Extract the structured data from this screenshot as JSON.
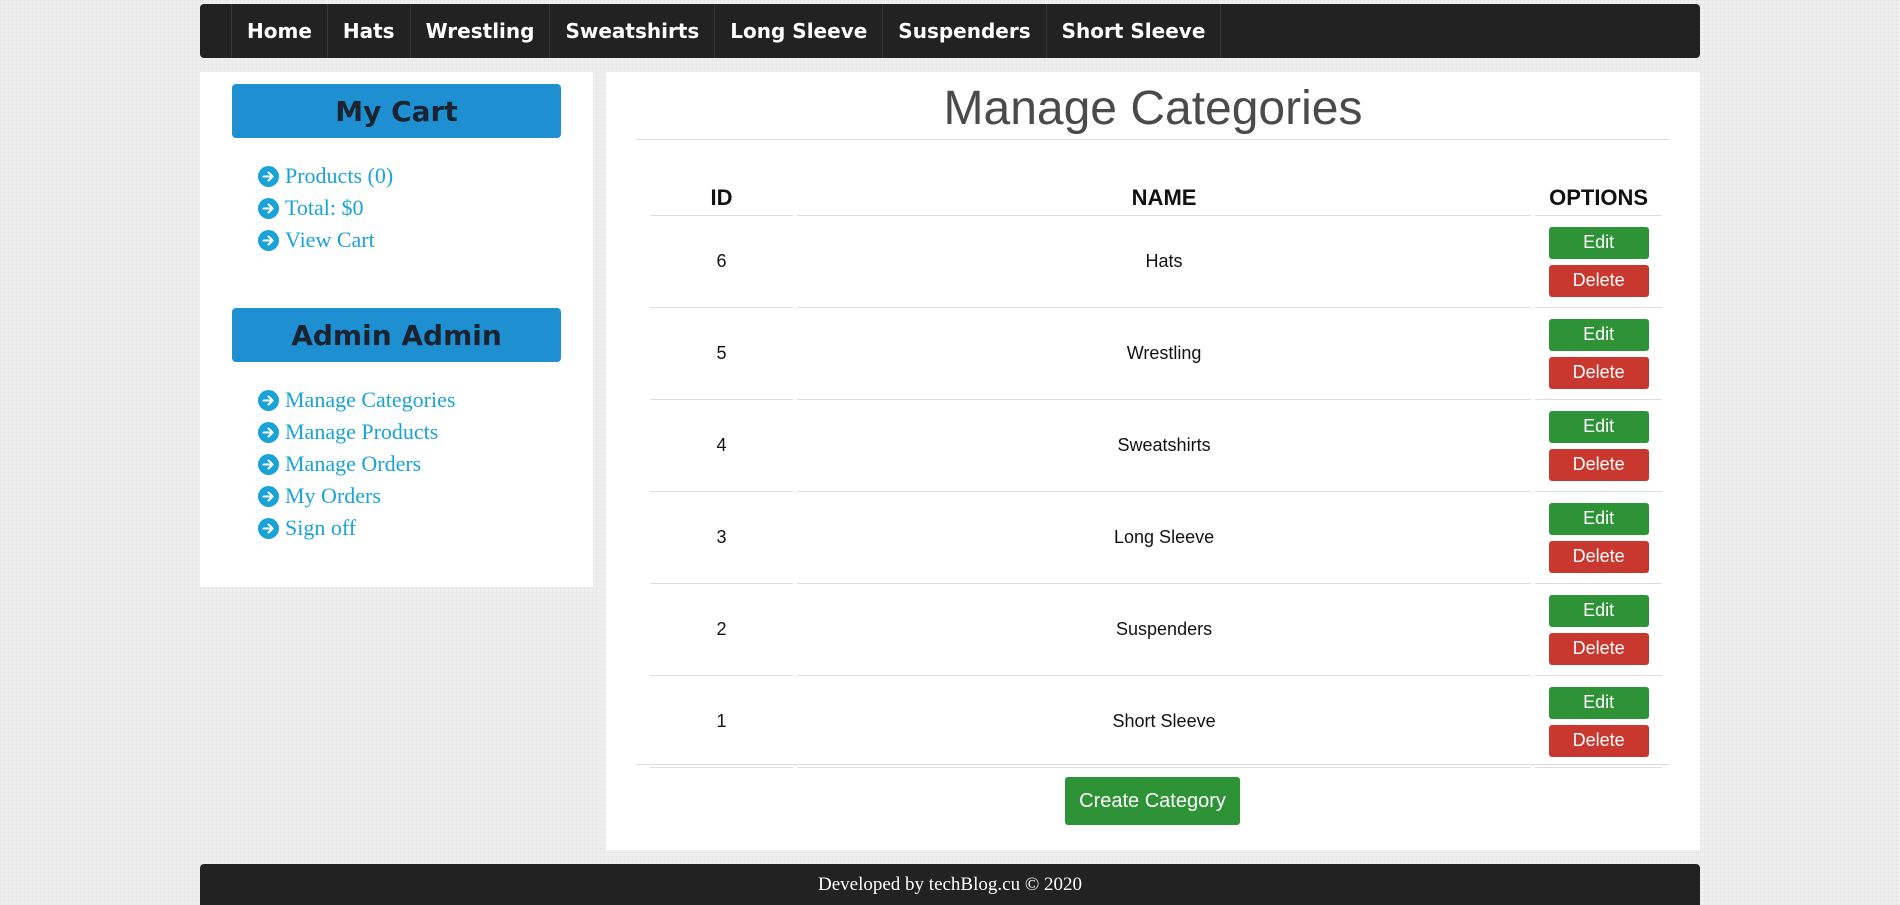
{
  "nav": {
    "items": [
      "Home",
      "Hats",
      "Wrestling",
      "Sweatshirts",
      "Long Sleeve",
      "Suspenders",
      "Short Sleeve"
    ]
  },
  "sidebar": {
    "cart": {
      "title": "My Cart",
      "links": [
        "Products (0)",
        "Total: $0",
        "View Cart"
      ]
    },
    "admin": {
      "title": "Admin Admin",
      "links": [
        "Manage Categories",
        "Manage Products",
        "Manage Orders",
        "My Orders",
        "Sign off"
      ]
    }
  },
  "main": {
    "title": "Manage Categories",
    "table": {
      "headers": [
        "ID",
        "NAME",
        "OPTIONS"
      ],
      "rows": [
        {
          "id": "6",
          "name": "Hats"
        },
        {
          "id": "5",
          "name": "Wrestling"
        },
        {
          "id": "4",
          "name": "Sweatshirts"
        },
        {
          "id": "3",
          "name": "Long Sleeve"
        },
        {
          "id": "2",
          "name": "Suspenders"
        },
        {
          "id": "1",
          "name": "Short Sleeve"
        }
      ],
      "edit_label": "Edit",
      "delete_label": "Delete"
    },
    "create_label": "Create Category"
  },
  "footer": {
    "text": "Developed by techBlog.cu © 2020"
  },
  "icons": {
    "sidebar_link": "arrow-circle-right-icon"
  },
  "colors": {
    "accent": "#1e90d2",
    "link": "#1aa3d6",
    "edit": "#2e9237",
    "delete": "#c9382e",
    "nav": "#222222"
  }
}
